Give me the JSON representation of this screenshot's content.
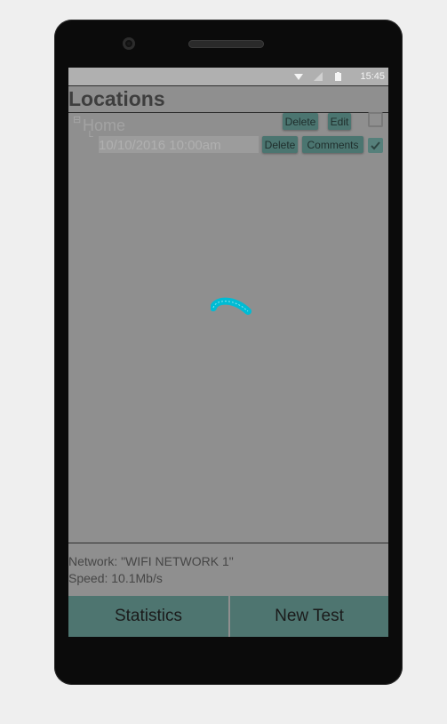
{
  "statusbar": {
    "time": "15:45"
  },
  "header": {
    "title": "Locations"
  },
  "locations": [
    {
      "name": "Home",
      "delete_label": "Delete",
      "edit_label": "Edit",
      "checked": false,
      "entries": [
        {
          "label": "10/10/2016 10:00am",
          "delete_label": "Delete",
          "comments_label": "Comments",
          "checked": true
        }
      ]
    }
  ],
  "network": {
    "network_text": "Network: \"WIFI NETWORK 1\"",
    "speed_text": "Speed: 10.1Mb/s"
  },
  "actions": {
    "statistics_label": "Statistics",
    "new_test_label": "New Test"
  },
  "colors": {
    "accent": "#4e7570",
    "spinner": "#00bcd4",
    "overlay": "#8f8f8f"
  }
}
